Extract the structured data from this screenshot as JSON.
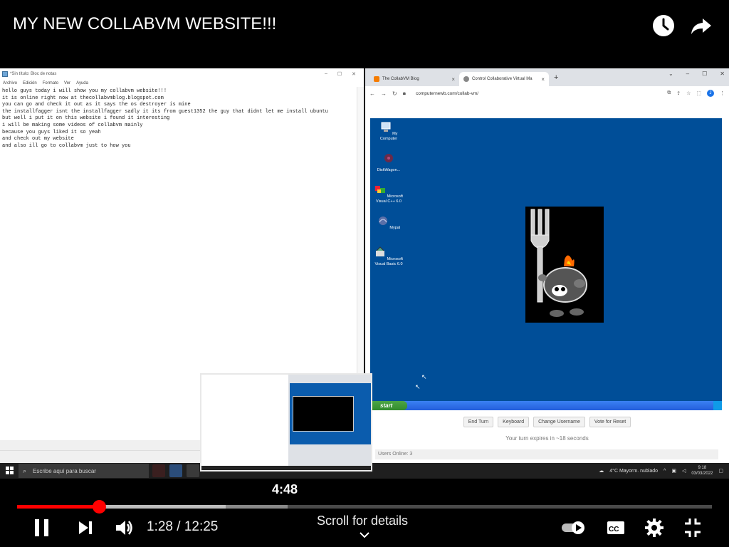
{
  "video": {
    "title": "MY NEW COLLABVM WEBSITE!!!",
    "icons": [
      "watch-later-icon",
      "share-icon"
    ]
  },
  "notepad": {
    "title": "*Sin título: Bloc de notas",
    "menu": [
      "Archivo",
      "Edición",
      "Formato",
      "Ver",
      "Ayuda"
    ],
    "lines": [
      "hello guys today i will show you my collabvm website!!!",
      "it is online right now at thecollabvmblog.blogspot.com",
      "you can go and check it out as it says the os destroyer is mine",
      "the installfagger isnt the installfagger sadly it its from guest1352 the guy that didnt let me install ubuntu",
      "but well i put it on this website i found it interesting",
      "i will be making some videos of collabvm mainly",
      "because you guys liked it so yeah",
      "and check out my website",
      "and also ill go to collabvm just to how you"
    ]
  },
  "browser": {
    "tabs": [
      {
        "label": "The CollabVM Blog",
        "active": false
      },
      {
        "label": "Control Collaborative Virtual Ma",
        "active": true
      }
    ],
    "url": "computernewb.com/collab-vm/",
    "profile_initial": "J"
  },
  "vm": {
    "desktop_icons": [
      {
        "label": "My Computer",
        "icon": "my-computer-icon"
      },
      {
        "label": "DiskWagon...",
        "icon": "diskwagon-icon"
      },
      {
        "label": "Microsoft Visual C++ 6.0",
        "icon": "visual-cpp-icon"
      },
      {
        "label": "Mypal",
        "icon": "mypal-icon"
      },
      {
        "label": "Microsoft Visual Basic 6.0",
        "icon": "visual-basic-icon"
      }
    ],
    "start_label": "start",
    "buttons": [
      "End Turn",
      "Keyboard",
      "Change Username",
      "Vote for Reset"
    ],
    "turn_text": "Your turn expires in ~18 seconds",
    "users_online": "Users Online: 3"
  },
  "windows_taskbar": {
    "search_placeholder": "Escribe aquí para buscar",
    "weather": "4°C  Mayorm. nublado",
    "time": "9:18",
    "date": "03/03/2022"
  },
  "player": {
    "hover_time": "4:48",
    "current_time": "1:28",
    "duration": "12:25",
    "time_display": "1:28 / 12:25",
    "scroll_label": "Scroll for details",
    "progress_played_fraction": 0.119,
    "controls": [
      "pause-icon",
      "next-icon",
      "volume-icon",
      "autoplay-toggle",
      "captions-icon",
      "settings-icon",
      "exit-fullscreen-icon"
    ]
  }
}
